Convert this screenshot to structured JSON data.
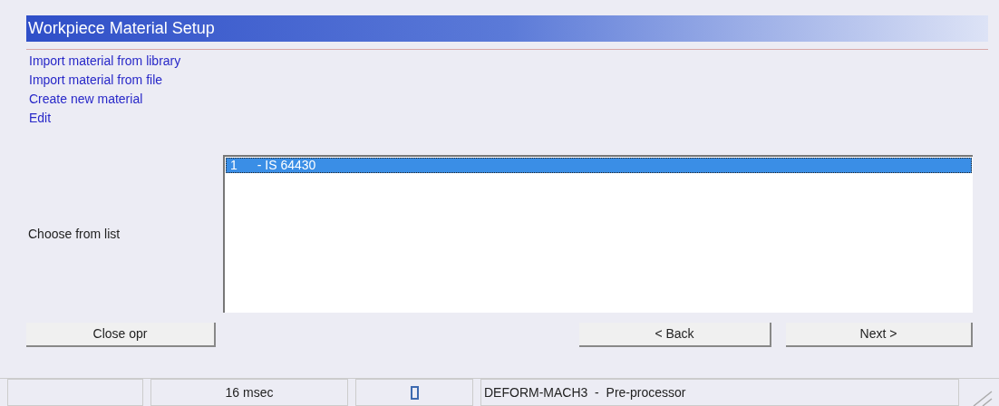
{
  "panel": {
    "title": "Workpiece Material Setup"
  },
  "actions": [
    {
      "label": "Import material from library"
    },
    {
      "label": "Import material from file"
    },
    {
      "label": "Create new material"
    },
    {
      "label": "Edit"
    }
  ],
  "list": {
    "label": "Choose from list",
    "items": [
      {
        "number": "1",
        "name": "- IS 64430",
        "selected": true
      }
    ]
  },
  "buttons": [
    {
      "label": "Close opr"
    },
    {
      "label": "< Back"
    },
    {
      "label": "Next >"
    }
  ],
  "status_bar": {
    "time": "16 msec",
    "app": "DEFORM-MACH3  -  Pre-processor"
  }
}
